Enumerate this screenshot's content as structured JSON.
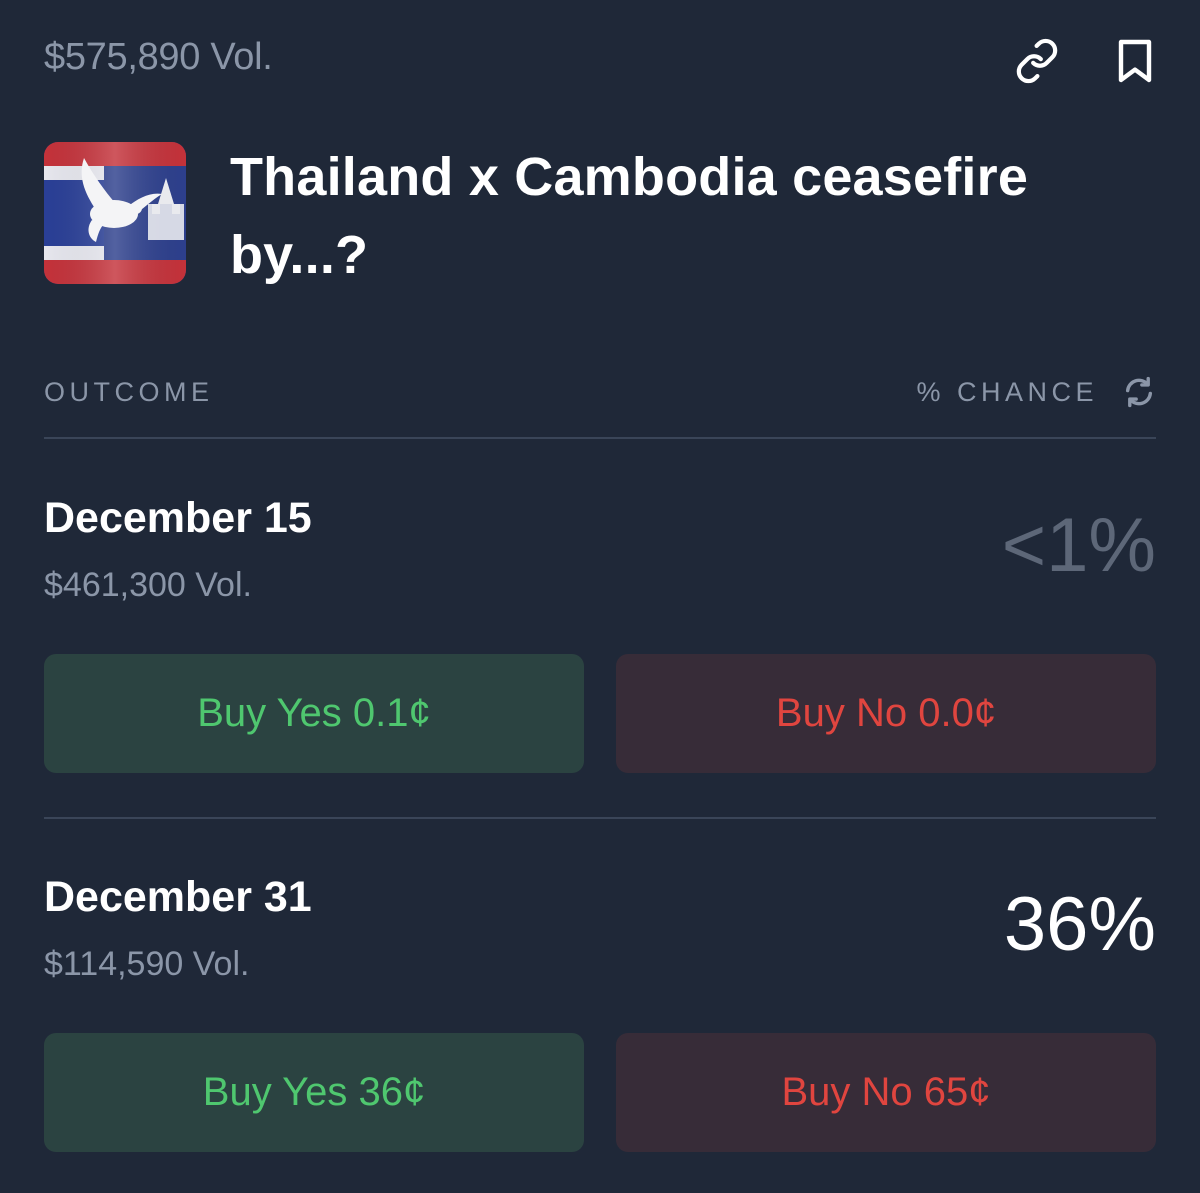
{
  "header": {
    "volume": "$575,890 Vol.",
    "title": "Thailand x Cambodia ceasefire by...?",
    "actions": [
      "link-icon",
      "bookmark-icon"
    ]
  },
  "table_header": {
    "outcome_label": "OUTCOME",
    "chance_label": "% CHANCE",
    "refresh_icon": "refresh-icon"
  },
  "outcomes": [
    {
      "name": "December 15",
      "volume": "$461,300 Vol.",
      "chance": "<1%",
      "buy_yes": "Buy Yes 0.1¢",
      "buy_no": "Buy No 0.0¢"
    },
    {
      "name": "December 31",
      "volume": "$114,590 Vol.",
      "chance": "36%",
      "buy_yes": "Buy Yes 36¢",
      "buy_no": "Buy No 65¢"
    }
  ],
  "colors": {
    "background": "#1f2838",
    "muted_text": "#8b96a8",
    "yes_text": "#4fc76f",
    "yes_bg": "#2b4341",
    "no_text": "#e0453f",
    "no_bg": "#372c38",
    "divider": "#3a4558"
  }
}
